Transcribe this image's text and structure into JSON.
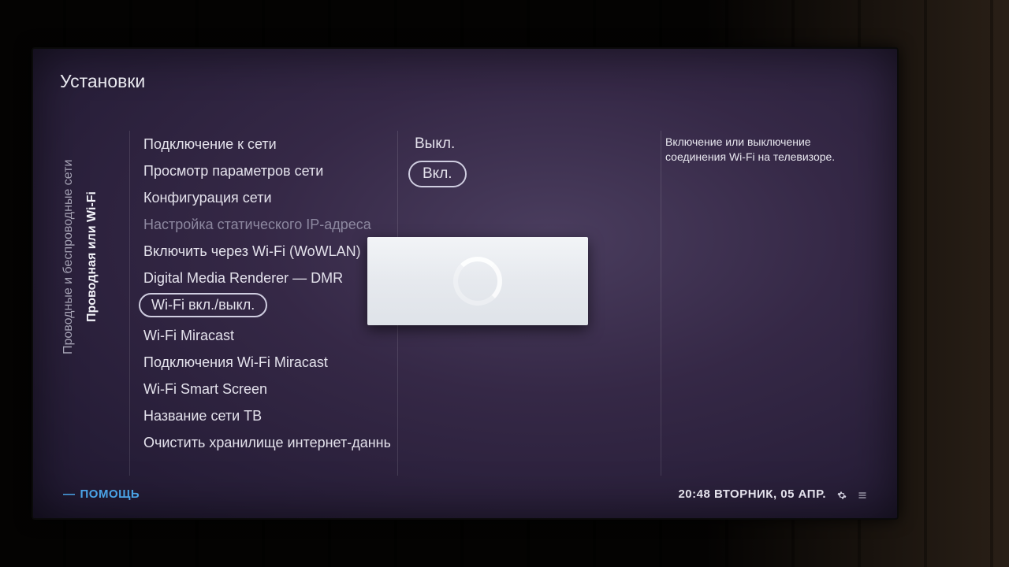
{
  "title": "Установки",
  "vertical_tabs": {
    "outer": "Проводные и беспроводные сети",
    "inner": "Проводная или Wi-Fi"
  },
  "menu": [
    {
      "label": "Подключение к сети",
      "disabled": false
    },
    {
      "label": "Просмотр параметров сети",
      "disabled": false
    },
    {
      "label": "Конфигурация сети",
      "disabled": false
    },
    {
      "label": "Настройка статического IP-адреса",
      "disabled": true,
      "chevron": true
    },
    {
      "label": "Включить через Wi-Fi (WoWLAN)",
      "disabled": false
    },
    {
      "label": "Digital Media Renderer — DMR",
      "disabled": false
    },
    {
      "label": "Wi-Fi вкл./выкл.",
      "disabled": false,
      "selected": true
    },
    {
      "label": "Wi-Fi Miracast",
      "disabled": false
    },
    {
      "label": "Подключения Wi-Fi Miracast",
      "disabled": false
    },
    {
      "label": "Wi-Fi Smart Screen",
      "disabled": false
    },
    {
      "label": "Название сети ТВ",
      "disabled": false
    },
    {
      "label": "Очистить хранилище интернет-данных",
      "disabled": false
    }
  ],
  "options": [
    {
      "label": "Выкл.",
      "selected": false
    },
    {
      "label": "Вкл.",
      "selected": true
    }
  ],
  "help_text": "Включение или выключение соединения Wi-Fi на телевизоре.",
  "footer": {
    "help_link": "ПОМОЩЬ",
    "clock": "20:48 ВТОРНИК, 05 АПР."
  }
}
